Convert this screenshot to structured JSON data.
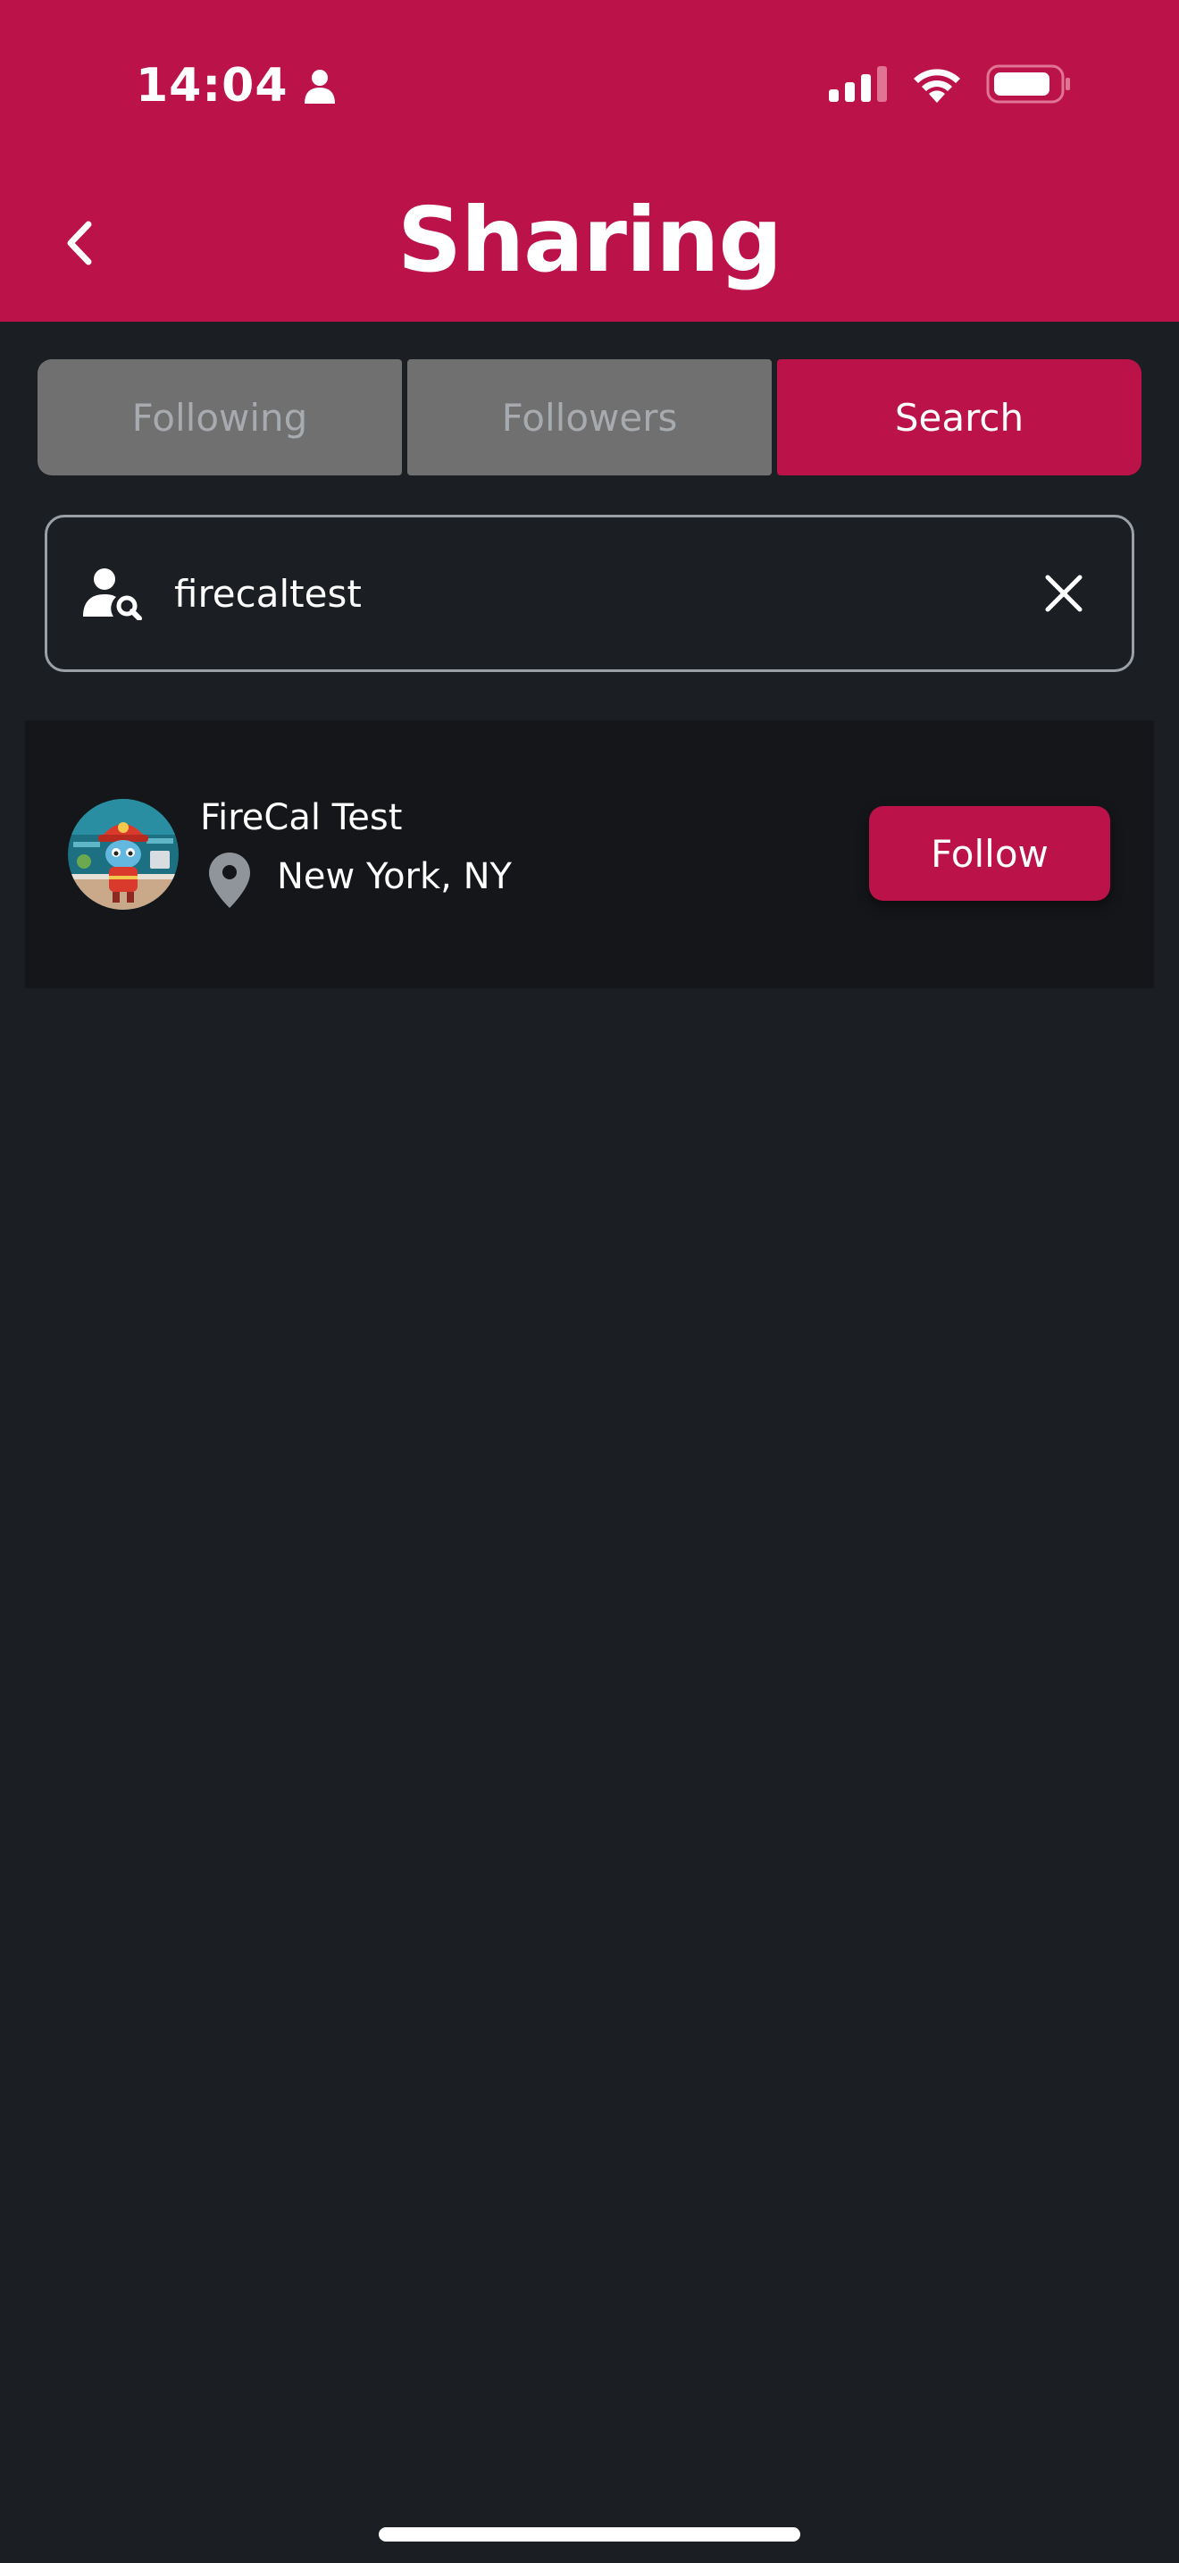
{
  "status_bar": {
    "time": "14:04",
    "icons": [
      "person-icon",
      "signal-icon",
      "wifi-icon",
      "battery-icon"
    ]
  },
  "header": {
    "title": "Sharing",
    "back_icon": "chevron-left-icon"
  },
  "tabs": [
    {
      "label": "Following",
      "active": false
    },
    {
      "label": "Followers",
      "active": false
    },
    {
      "label": "Search",
      "active": true
    }
  ],
  "search": {
    "value": "firecaltest",
    "icon": "user-search-icon",
    "clear_icon": "close-icon"
  },
  "results": [
    {
      "name": "FireCal Test",
      "location": "New York, NY",
      "action_label": "Follow"
    }
  ],
  "colors": {
    "brand": "#bb124a",
    "background": "#1b1f23",
    "card": "#141619",
    "inactive_tab": "#707070"
  }
}
